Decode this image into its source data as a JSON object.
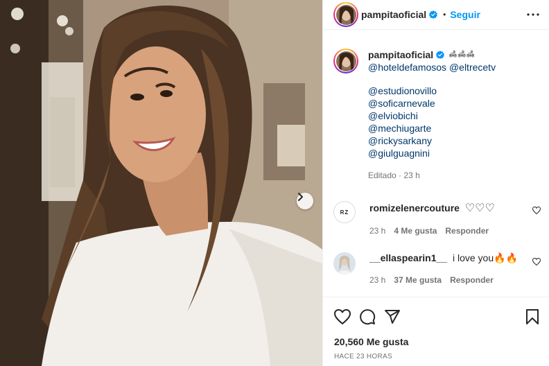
{
  "post": {
    "username": "pampitaoficial",
    "follow_label": "Seguir",
    "separator": "•"
  },
  "caption": {
    "username": "pampitaoficial",
    "emoji": "🛋🛋🛋",
    "line1_mentions": [
      "@hoteldefamosos",
      "@eltrecetv"
    ],
    "mentions": [
      "@estudionovillo",
      "@soficarnevale",
      "@elviobichi",
      "@mechiugarte",
      "@rickysarkany",
      "@giulguagnini"
    ],
    "edited": "Editado",
    "edited_sep": "·",
    "edited_time": "23 h"
  },
  "comments": [
    {
      "avatar_text": "RZ",
      "username": "romizelenercouture",
      "text": "♡♡♡",
      "time": "23 h",
      "likes": "4 Me gusta",
      "reply": "Responder"
    },
    {
      "username": "__ellaspearin1__",
      "text": "i love you🔥🔥",
      "time": "23 h",
      "likes": "37 Me gusta",
      "reply": "Responder"
    }
  ],
  "stats": {
    "likes": "20,560 Me gusta",
    "time_ago": "HACE 23 HORAS"
  },
  "icons": {
    "verified": "verified-badge-icon",
    "more": "more-options-icon",
    "like": "heart-icon",
    "comment": "comment-icon",
    "share": "share-icon",
    "save": "bookmark-icon",
    "next": "chevron-right-icon"
  },
  "colors": {
    "accent": "#0095f6",
    "mention": "#00376b",
    "muted": "#737373",
    "text": "#262626"
  }
}
